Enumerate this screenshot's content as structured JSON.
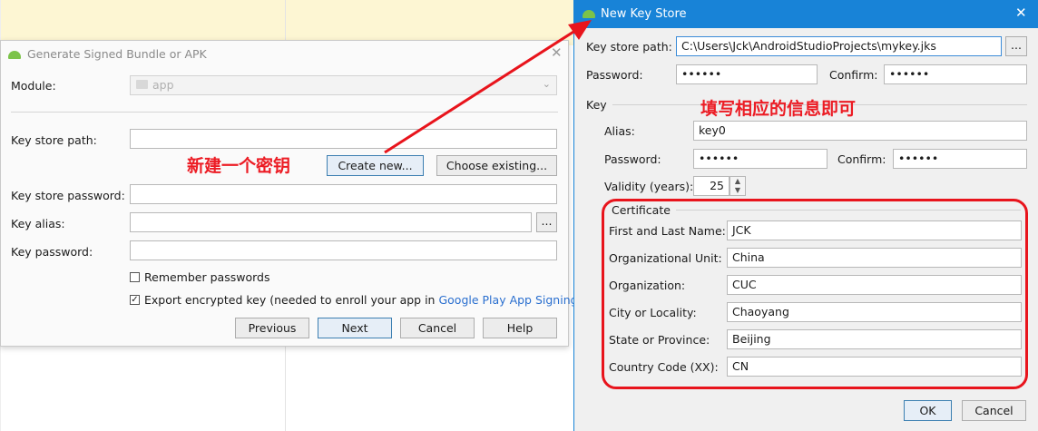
{
  "generate_dialog": {
    "title": "Generate Signed Bundle or APK",
    "module_label": "Module:",
    "module_value": "app",
    "key_store_path_label": "Key store path:",
    "key_store_path_value": "",
    "create_new_label": "Create new...",
    "choose_existing_label": "Choose existing...",
    "key_store_password_label": "Key store password:",
    "key_alias_label": "Key alias:",
    "browse_label": "...",
    "key_password_label": "Key password:",
    "remember_passwords_label": "Remember passwords",
    "remember_passwords_checked": false,
    "export_key_label": "Export encrypted key",
    "export_key_hint": "(needed to enroll your app in",
    "export_key_link": "Google Play App Signing",
    "export_key_close": ")",
    "export_key_checked": true,
    "buttons": {
      "previous": "Previous",
      "next": "Next",
      "cancel": "Cancel",
      "help": "Help"
    }
  },
  "key_store_dialog": {
    "title": "New Key Store",
    "key_store_path_label": "Key store path:",
    "key_store_path_value": "C:\\Users\\Jck\\AndroidStudioProjects\\mykey.jks",
    "browse_label": "...",
    "password_label": "Password:",
    "password_value": "••••••",
    "confirm_label": "Confirm:",
    "confirm_value": "••••••",
    "key_group_label": "Key",
    "alias_label": "Alias:",
    "alias_value": "key0",
    "key_password_label": "Password:",
    "key_password_value": "••••••",
    "key_confirm_label": "Confirm:",
    "key_confirm_value": "••••••",
    "validity_label": "Validity (years):",
    "validity_value": "25",
    "certificate": {
      "group_label": "Certificate",
      "first_last_name_label": "First and Last Name:",
      "first_last_name_value": "JCK",
      "org_unit_label": "Organizational Unit:",
      "org_unit_value": "China",
      "organization_label": "Organization:",
      "organization_value": "CUC",
      "city_label": "City or Locality:",
      "city_value": "Chaoyang",
      "state_label": "State or Province:",
      "state_value": "Beijing",
      "country_label": "Country Code (XX):",
      "country_value": "CN"
    },
    "buttons": {
      "ok": "OK",
      "cancel": "Cancel"
    }
  },
  "annotations": {
    "create_key_note": "新建一个密钥",
    "fill_info_note": "填写相应的信息即可",
    "color": "#ec1c24"
  },
  "colors": {
    "titlebar": "#1883d7",
    "link": "#2a6fcf",
    "android_green": "#7cc34a"
  }
}
